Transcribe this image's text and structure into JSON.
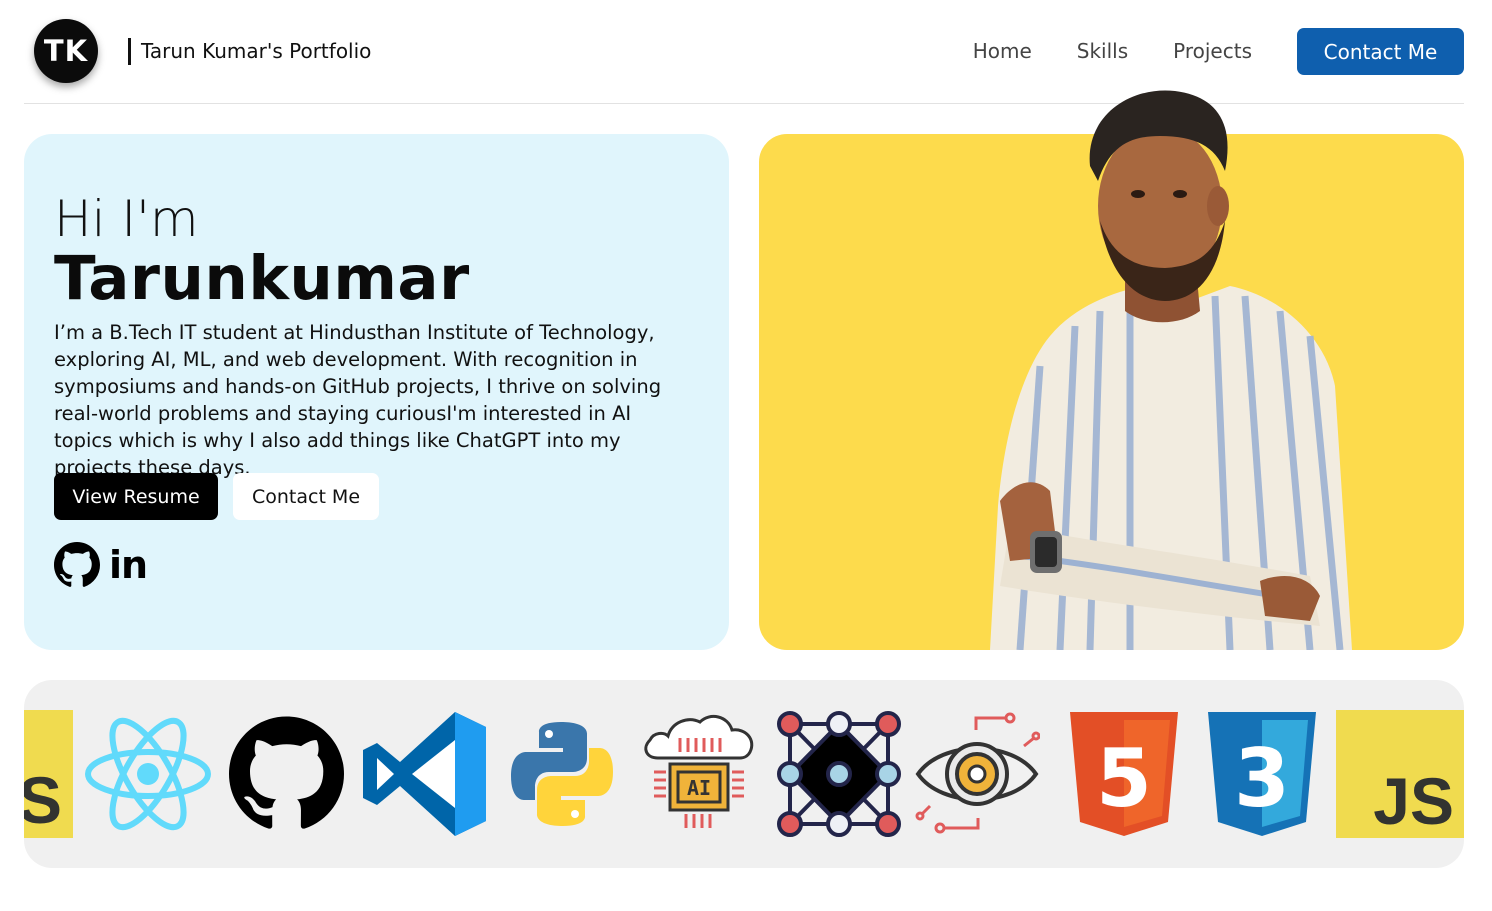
{
  "nav": {
    "logo_initials": "TK",
    "brand": "Tarun Kumar's Portfolio",
    "links": [
      "Home",
      "Skills",
      "Projects"
    ],
    "cta": "Contact Me"
  },
  "hero": {
    "greeting": "Hi I'm",
    "name": "Tarunkumar",
    "bio": "I’m a B.Tech IT student at Hindusthan Institute of Technology, exploring AI, ML, and web development. With recognition in symposiums and hands-on GitHub projects, I thrive on solving real-world problems and staying curiousI'm interested in AI topics which is why I also add things like ChatGPT into my projects these days.",
    "resume_button": "View Resume",
    "contact_button": "Contact Me",
    "social_icons": [
      "github-icon",
      "linkedin-icon"
    ],
    "linkedin_glyph": "in"
  },
  "skills_strip": {
    "icons": [
      "javascript-icon",
      "react-icon",
      "github-icon",
      "vscode-icon",
      "python-icon",
      "ai-cloud-icon",
      "neural-network-icon",
      "vision-gear-icon",
      "html5-icon",
      "css3-icon",
      "javascript-icon"
    ],
    "html_digit": "5",
    "css_digit": "3",
    "js_text": "JS",
    "ai_text": "AI"
  },
  "colors": {
    "nav_cta": "#0f5fae",
    "intro_bg": "#e0f5fc",
    "photo_bg": "#fddb4c",
    "strip_bg": "#f0f0f0",
    "react": "#61dafb",
    "html5": "#e34f26",
    "css3": "#1572b6",
    "js": "#f0db4f"
  }
}
